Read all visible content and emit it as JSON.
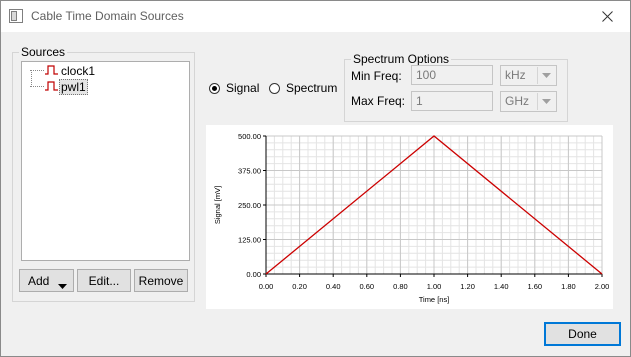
{
  "window": {
    "title": "Cable Time Domain Sources"
  },
  "sources": {
    "group_label": "Sources",
    "items": [
      {
        "label": "clock1",
        "selected": false
      },
      {
        "label": "pwl1",
        "selected": true
      }
    ],
    "add_label": "Add",
    "edit_label": "Edit...",
    "remove_label": "Remove"
  },
  "view_mode": {
    "signal_label": "Signal",
    "spectrum_label": "Spectrum",
    "selected": "Signal"
  },
  "spectrum_options": {
    "group_label": "Spectrum Options",
    "min_freq_label": "Min Freq:",
    "min_freq_value": "100",
    "min_freq_unit": "kHz",
    "max_freq_label": "Max Freq:",
    "max_freq_value": "1",
    "max_freq_unit": "GHz"
  },
  "chart_data": {
    "type": "line",
    "xlabel": "Time [ns]",
    "ylabel": "Signal [mV]",
    "xlim": [
      0,
      2
    ],
    "ylim": [
      0,
      500
    ],
    "x_ticks": [
      "0.00",
      "0.20",
      "0.40",
      "0.60",
      "0.80",
      "1.00",
      "1.20",
      "1.40",
      "1.60",
      "1.80",
      "2.00"
    ],
    "y_ticks": [
      "0.00",
      "125.00",
      "250.00",
      "375.00",
      "500.00"
    ],
    "grid": true,
    "series": [
      {
        "color": "#cc0000",
        "x": [
          0,
          1,
          2
        ],
        "y": [
          0,
          500,
          0
        ]
      }
    ]
  },
  "footer": {
    "done_label": "Done"
  }
}
